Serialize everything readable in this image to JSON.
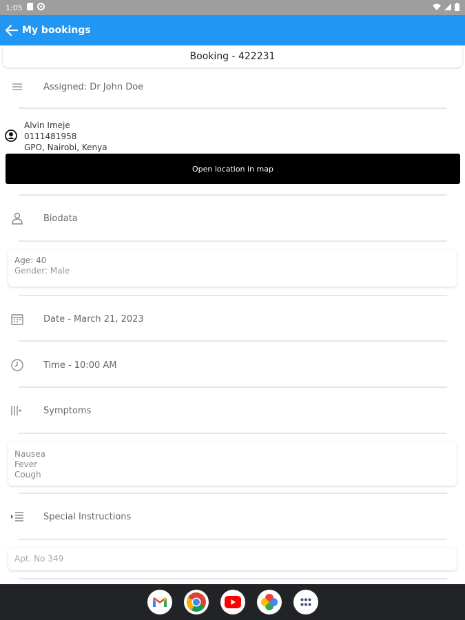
{
  "status_bar": {
    "time": "1:05",
    "icons": [
      "sim-card-icon",
      "settings-circle-icon",
      "wifi-icon",
      "signal-icon",
      "battery-icon"
    ]
  },
  "app_bar": {
    "back_icon": "arrow-left-icon",
    "title": "My bookings",
    "color": "#2196f3"
  },
  "booking": {
    "header": "Booking - 422231",
    "assigned": "Assigned: Dr John Doe",
    "contact": {
      "name": "Alvin Imeje",
      "phone": "0111481958",
      "address": "GPO, Nairobi, Kenya"
    },
    "map_button": "Open location in map",
    "biodata_label": "Biodata",
    "biodata": {
      "age": "Age: 40",
      "gender": "Gender: Male"
    },
    "date": "Date - March 21, 2023",
    "time": "Time - 10:00 AM",
    "symptoms_label": "Symptoms",
    "symptoms": [
      "Nausea",
      "Fever",
      "Cough"
    ],
    "special_label": "Special Instructions",
    "special_value": "Apt. No 349"
  },
  "dock": {
    "apps": [
      "gmail-icon",
      "chrome-icon",
      "youtube-icon",
      "photos-icon",
      "app-drawer-icon"
    ]
  }
}
